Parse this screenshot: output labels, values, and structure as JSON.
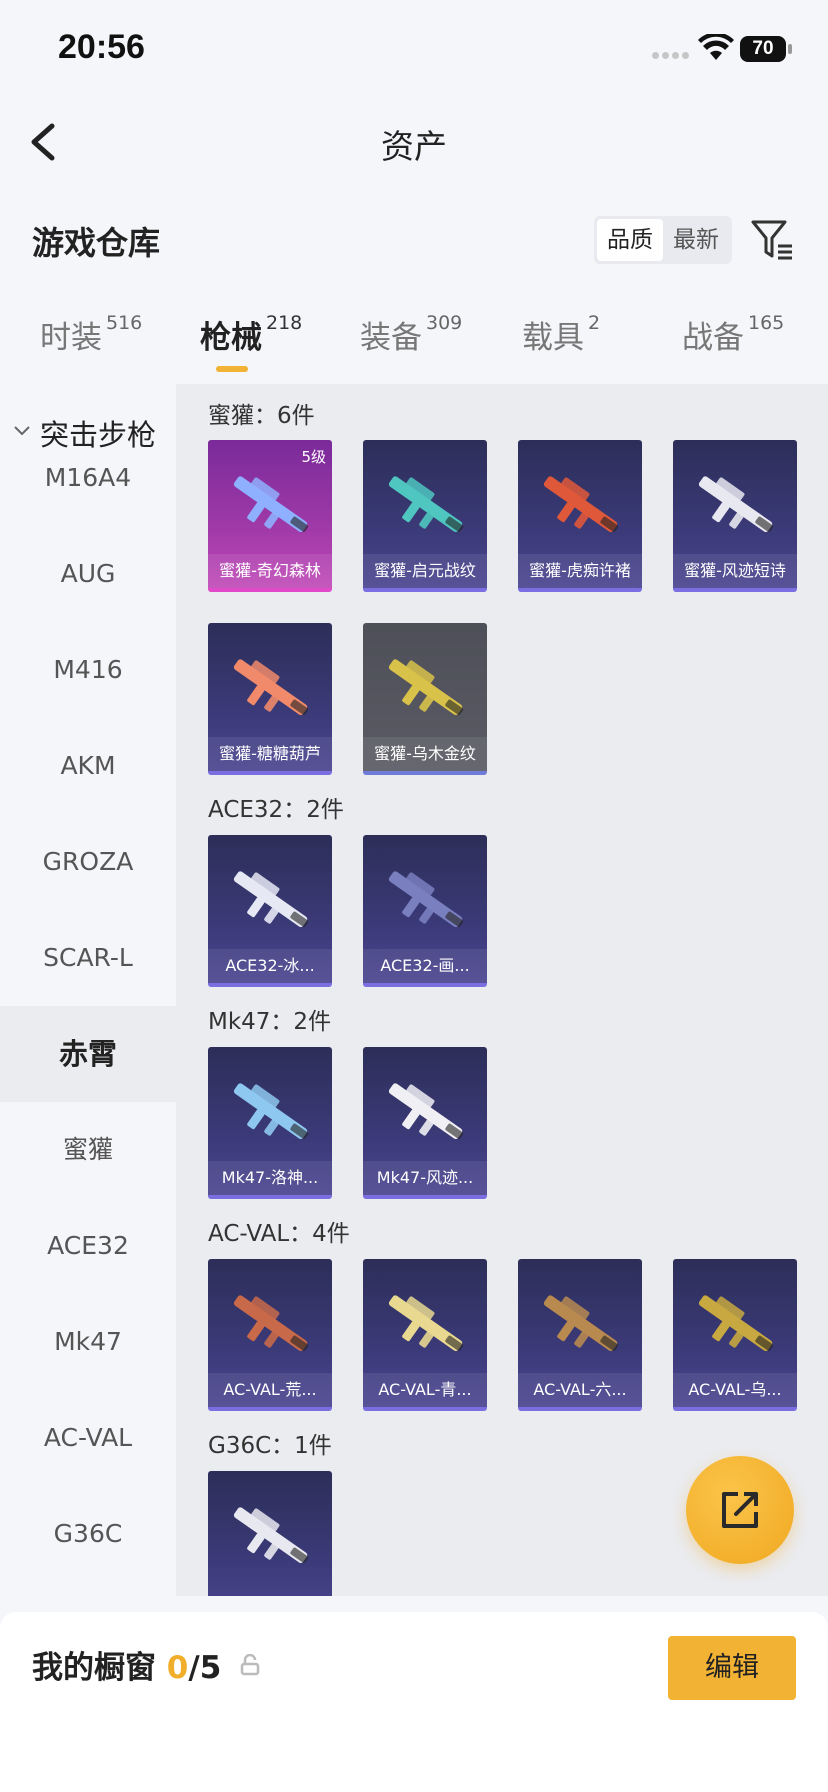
{
  "status_bar": {
    "time": "20:56",
    "battery": "70"
  },
  "nav": {
    "title": "资产"
  },
  "header": {
    "title": "游戏仓库",
    "sort_options": [
      "品质",
      "最新"
    ]
  },
  "tabs": [
    {
      "label": "时装",
      "count": "516"
    },
    {
      "label": "枪械",
      "count": "218"
    },
    {
      "label": "装备",
      "count": "309"
    },
    {
      "label": "载具",
      "count": "2"
    },
    {
      "label": "战备",
      "count": "165"
    }
  ],
  "sidebar": {
    "group": "突击步枪",
    "items": [
      "M16A4",
      "AUG",
      "M416",
      "AKM",
      "GROZA",
      "SCAR-L",
      "赤霄",
      "蜜獾",
      "ACE32",
      "Mk47",
      "AC-VAL",
      "G36C"
    ]
  },
  "sections": [
    {
      "title": "蜜獾：6件",
      "items": [
        {
          "name": "蜜獾-奇幻森林",
          "level": "5级",
          "style": "pink",
          "color": "#8fb0ff"
        },
        {
          "name": "蜜獾-启元战纹",
          "style": "blue",
          "color": "#4fc6c0"
        },
        {
          "name": "蜜獾-虎痴许褚",
          "style": "blue",
          "color": "#e0583a"
        },
        {
          "name": "蜜獾-风迹短诗",
          "style": "blue",
          "color": "#e8e8f0"
        },
        {
          "name": "蜜獾-糖糖葫芦",
          "style": "blue",
          "color": "#f08a6a"
        },
        {
          "name": "蜜獾-乌木金纹",
          "style": "gray",
          "color": "#d8c24a"
        }
      ]
    },
    {
      "title": "ACE32：2件",
      "items": [
        {
          "name": "ACE32-冰...",
          "style": "blue",
          "color": "#e6e8f4"
        },
        {
          "name": "ACE32-画...",
          "style": "blue",
          "color": "#7a7fc0"
        }
      ]
    },
    {
      "title": "Mk47：2件",
      "items": [
        {
          "name": "Mk47-洛神...",
          "style": "blue",
          "color": "#8ec8f0"
        },
        {
          "name": "Mk47-风迹...",
          "style": "blue",
          "color": "#f0f0f4"
        }
      ]
    },
    {
      "title": "AC-VAL：4件",
      "items": [
        {
          "name": "AC-VAL-荒...",
          "style": "blue",
          "color": "#c86a4a"
        },
        {
          "name": "AC-VAL-青...",
          "style": "blue",
          "color": "#e8d890"
        },
        {
          "name": "AC-VAL-六...",
          "style": "blue",
          "color": "#b88a50"
        },
        {
          "name": "AC-VAL-乌...",
          "style": "blue",
          "color": "#c8a840"
        }
      ]
    },
    {
      "title": "G36C：1件",
      "items": [
        {
          "name": "",
          "style": "blue",
          "color": "#e8e8f0"
        }
      ]
    }
  ],
  "bottom": {
    "label": "我的橱窗",
    "current": "0",
    "total": "/5",
    "edit": "编辑"
  },
  "colors": {
    "accent": "#f2b233"
  }
}
